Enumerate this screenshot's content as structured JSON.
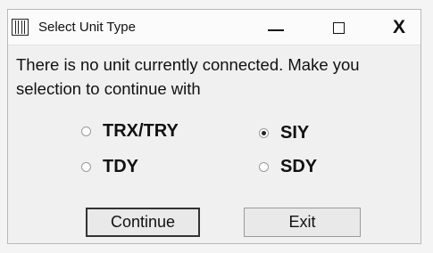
{
  "window": {
    "title": "Select Unit Type",
    "close_label": "X"
  },
  "message": "There is no unit currently connected. Make you selection to continue with",
  "options": [
    {
      "label": "TRX/TRY",
      "selected": false
    },
    {
      "label": "SIY",
      "selected": true
    },
    {
      "label": "TDY",
      "selected": false
    },
    {
      "label": "SDY",
      "selected": false
    }
  ],
  "buttons": {
    "continue_label": "Continue",
    "exit_label": "Exit"
  }
}
